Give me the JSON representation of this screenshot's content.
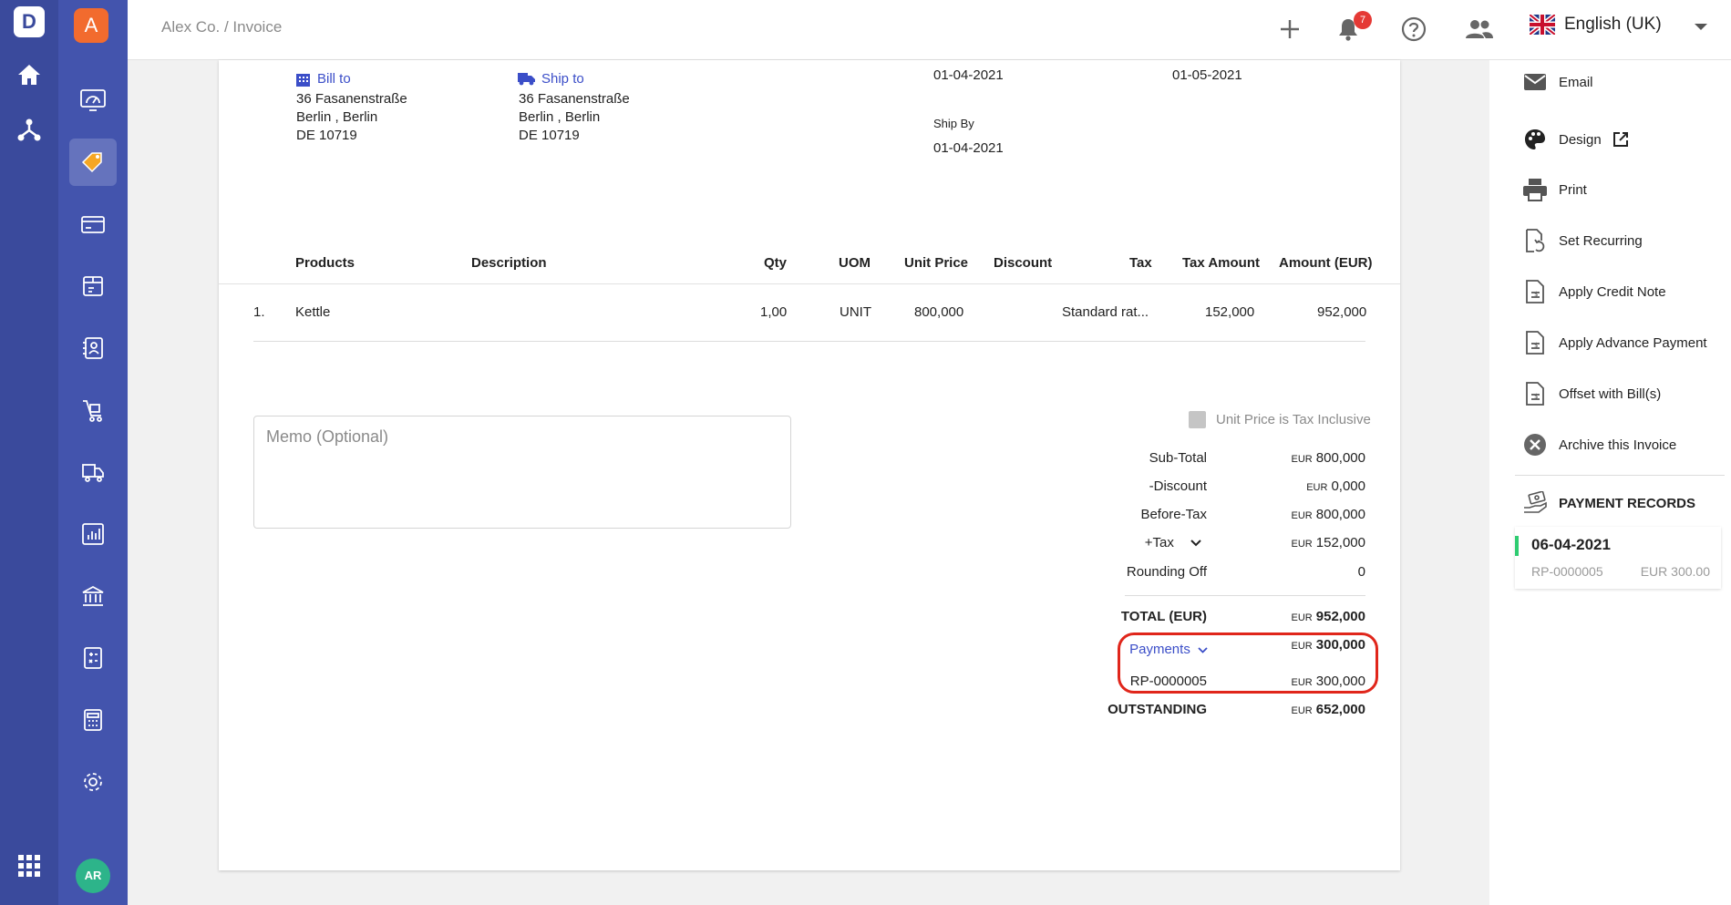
{
  "rail": {
    "logo": "D"
  },
  "sidebar": {
    "org_initial": "A",
    "avatar_initials": "AR"
  },
  "topbar": {
    "breadcrumb": "Alex Co. / Invoice",
    "notifications_count": "7",
    "language": "English (UK)"
  },
  "invoice": {
    "bill_to": {
      "label": "Bill to",
      "lines": [
        "36 Fasanenstraße",
        "Berlin , Berlin",
        "DE 10719"
      ]
    },
    "ship_to": {
      "label": "Ship to",
      "lines": [
        "36 Fasanenstraße",
        "Berlin , Berlin",
        "DE 10719"
      ]
    },
    "date_1": "01-04-2021",
    "date_2": "01-05-2021",
    "ship_by_label": "Ship By",
    "ship_by": "01-04-2021",
    "table": {
      "headers": [
        "Products",
        "Description",
        "Qty",
        "UOM",
        "Unit Price",
        "Discount",
        "Tax",
        "Tax Amount",
        "Amount (EUR)"
      ],
      "rows": [
        {
          "no": "1.",
          "product": "Kettle",
          "description": "",
          "qty": "1,00",
          "uom": "UNIT",
          "unit_price": "800,000",
          "discount": "",
          "tax": "Standard rat...",
          "tax_amount": "152,000",
          "amount": "952,000"
        }
      ]
    },
    "memo_placeholder": "Memo (Optional)",
    "tax_inclusive_label": "Unit Price is Tax Inclusive",
    "totals": {
      "currency": "EUR",
      "subtotal_label": "Sub-Total",
      "subtotal": "800,000",
      "discount_label": "-Discount",
      "discount": "0,000",
      "before_tax_label": "Before-Tax",
      "before_tax": "800,000",
      "tax_label": "+Tax",
      "tax": "152,000",
      "rounding_label": "Rounding Off",
      "rounding": "0",
      "total_label": "TOTAL (EUR)",
      "total": "952,000",
      "payments_label": "Payments",
      "payments": "300,000",
      "payment_ref": "RP-0000005",
      "payment_ref_amount": "300,000",
      "outstanding_label": "OUTSTANDING",
      "outstanding": "652,000"
    }
  },
  "actions": {
    "email": "Email",
    "design": "Design",
    "print": "Print",
    "set_recurring": "Set Recurring",
    "apply_credit_note": "Apply Credit Note",
    "apply_advance_payment": "Apply Advance Payment",
    "offset_with_bills": "Offset with Bill(s)",
    "archive": "Archive this Invoice"
  },
  "payment_records": {
    "heading": "PAYMENT RECORDS",
    "items": [
      {
        "date": "06-04-2021",
        "number": "RP-0000005",
        "amount": "EUR 300.00"
      }
    ]
  },
  "colors": {
    "rail": "#3a4a9c",
    "sidebar": "#4354ad",
    "accent": "#3b4ec8",
    "highlight": "#e0261b",
    "org": "#f26b2e",
    "avatar": "#2db48a"
  }
}
